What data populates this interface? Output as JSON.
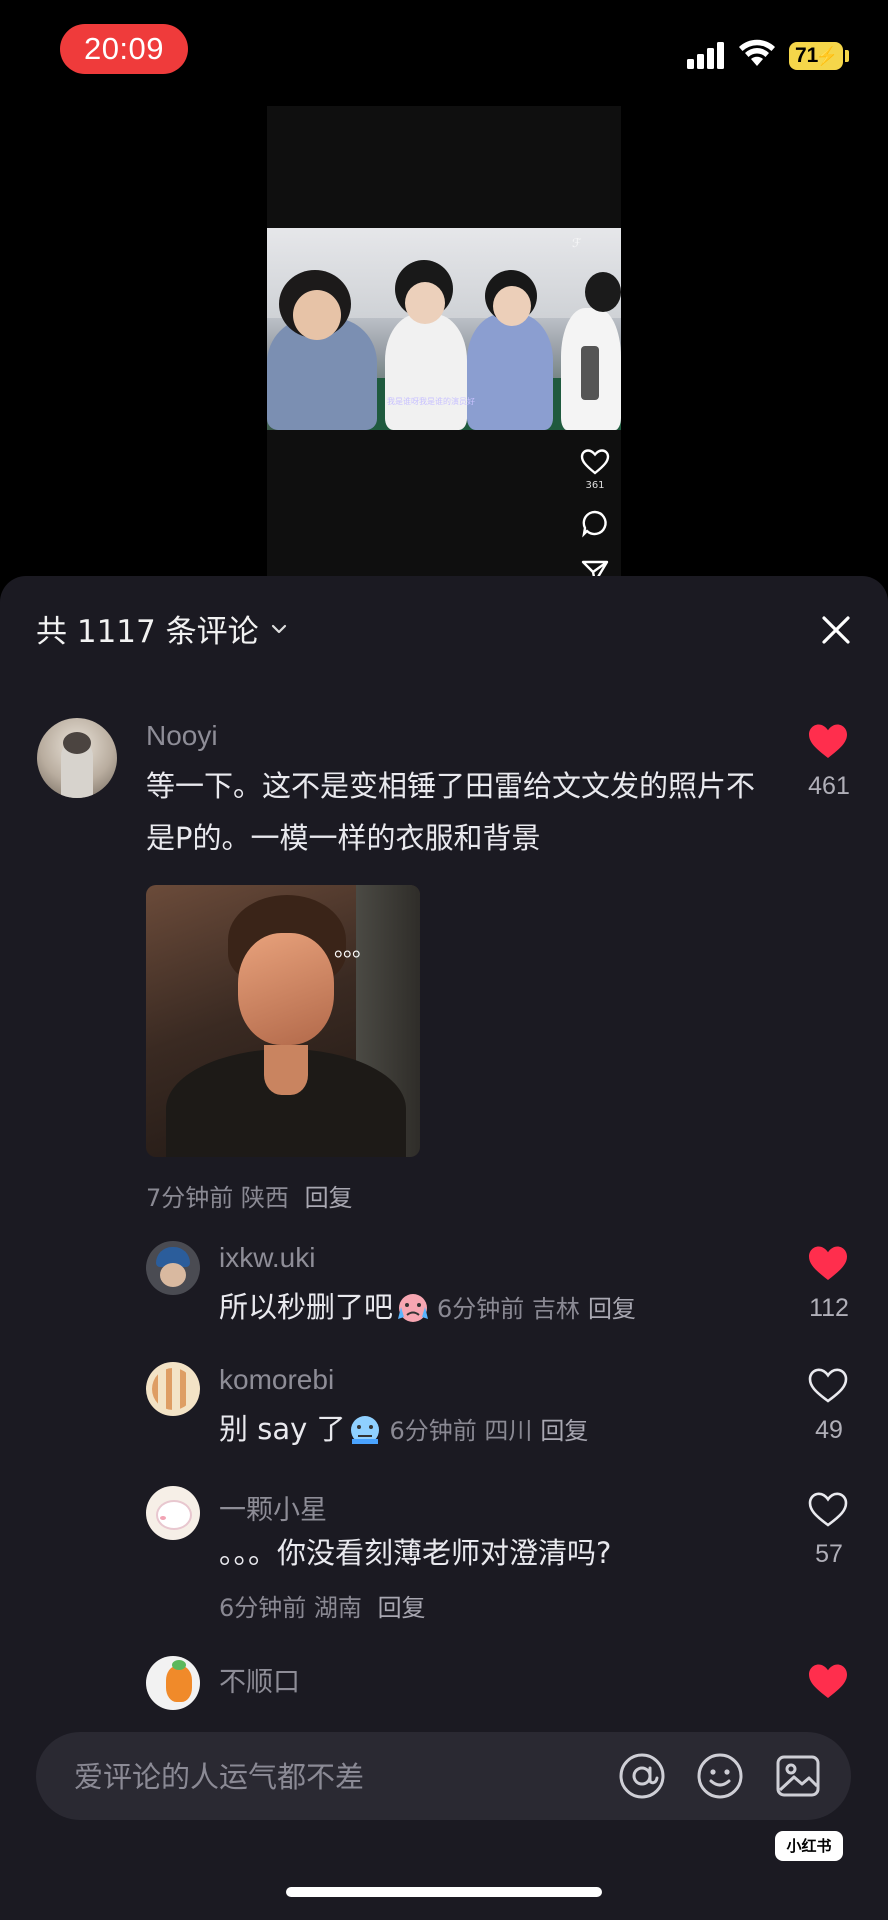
{
  "status_bar": {
    "time": "20:09",
    "battery": "71"
  },
  "video": {
    "subtitle": "我是谁呀我是谁的演员好",
    "like_count": "361"
  },
  "comments_header": {
    "title": "共 1117 条评论"
  },
  "comments": [
    {
      "username": "Nooyi",
      "text": "等一下。这不是变相锤了田雷给文文发的照片不是P的。一模一样的衣服和背景",
      "image_overlay": "。。。",
      "time": "7分钟前",
      "location": "陕西",
      "reply_label": "回复",
      "likes": "461",
      "liked": true
    },
    {
      "username": "ixkw.uki",
      "text": "所以秒删了吧",
      "time": "6分钟前",
      "location": "吉林",
      "reply_label": "回复",
      "likes": "112",
      "liked": true
    },
    {
      "username": "komorebi",
      "text": "别 say 了",
      "time": "6分钟前",
      "location": "四川",
      "reply_label": "回复",
      "likes": "49",
      "liked": false
    },
    {
      "username": "一颗小星",
      "text": "。。。你没看刻薄老师对澄清吗?",
      "time": "6分钟前",
      "location": "湖南",
      "reply_label": "回复",
      "likes": "57",
      "liked": false
    },
    {
      "username": "不顺口",
      "liked": true
    }
  ],
  "input": {
    "placeholder": "爱评论的人运气都不差"
  },
  "watermark": "小红书",
  "colors": {
    "liked": "#ff2e4d",
    "sheet_bg": "#1b1a22",
    "time_pill": "#ef3b3b",
    "battery": "#f5d64a"
  },
  "icons": [
    "signal-icon",
    "wifi-icon",
    "battery-icon",
    "chevron-down-icon",
    "close-icon",
    "heart-icon",
    "at-icon",
    "emoji-icon",
    "image-icon"
  ]
}
